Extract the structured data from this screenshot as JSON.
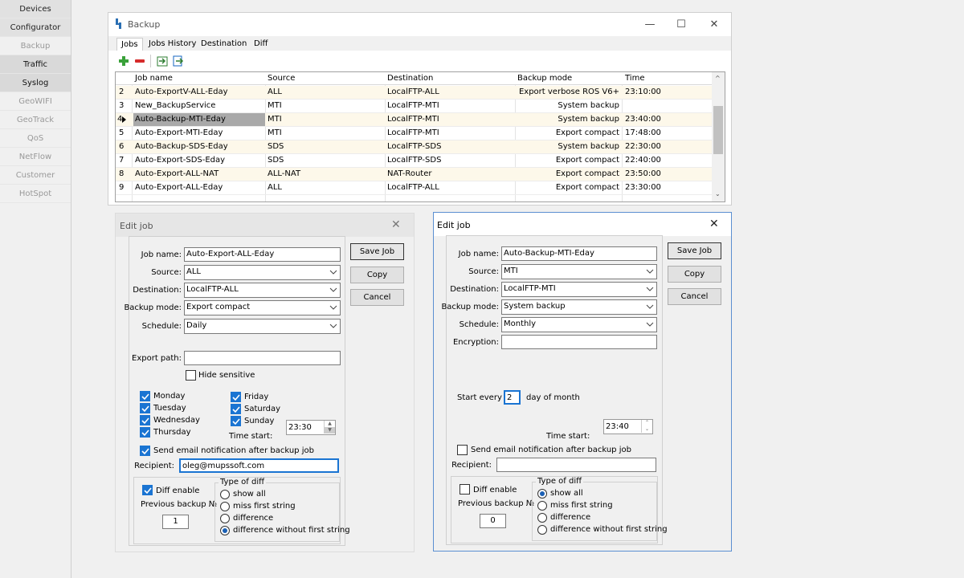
{
  "sidebar": {
    "items": [
      "Devices",
      "Configurator",
      "Backup",
      "Traffic",
      "Syslog",
      "GeoWIFI",
      "GeoTrack",
      "QoS",
      "NetFlow",
      "Customer",
      "HotSpot"
    ]
  },
  "window": {
    "title": "Backup",
    "tabs": [
      "Jobs",
      "Jobs History",
      "Destination",
      "Diff"
    ]
  },
  "grid": {
    "columns": [
      "Job name",
      "Source",
      "Destination",
      "Backup mode",
      "Time"
    ],
    "rows": [
      {
        "num": "2",
        "name": "Auto-ExportV-ALL-Eday",
        "source": "ALL",
        "dest": "LocalFTP-ALL",
        "mode": "Export verbose ROS V6+",
        "time": "23:10:00"
      },
      {
        "num": "3",
        "name": "New_BackupService",
        "source": "MTI",
        "dest": "LocalFTP-MTI",
        "mode": "System backup",
        "time": ""
      },
      {
        "num": "4",
        "name": "Auto-Backup-MTI-Eday",
        "source": "MTI",
        "dest": "LocalFTP-MTI",
        "mode": "System backup",
        "time": "23:40:00"
      },
      {
        "num": "5",
        "name": "Auto-Export-MTI-Eday",
        "source": "MTI",
        "dest": "LocalFTP-MTI",
        "mode": "Export compact",
        "time": "17:48:00"
      },
      {
        "num": "6",
        "name": "Auto-Backup-SDS-Eday",
        "source": "SDS",
        "dest": "LocalFTP-SDS",
        "mode": "System backup",
        "time": "22:30:00"
      },
      {
        "num": "7",
        "name": "Auto-Export-SDS-Eday",
        "source": "SDS",
        "dest": "LocalFTP-SDS",
        "mode": "Export compact",
        "time": "22:40:00"
      },
      {
        "num": "8",
        "name": "Auto-Export-ALL-NAT",
        "source": "ALL-NAT",
        "dest": "NAT-Router",
        "mode": "Export compact",
        "time": "23:50:00"
      },
      {
        "num": "9",
        "name": "Auto-Export-ALL-Eday",
        "source": "ALL",
        "dest": "LocalFTP-ALL",
        "mode": "Export compact",
        "time": "23:30:00"
      }
    ]
  },
  "edit1": {
    "title": "Edit job",
    "labels": {
      "jobname": "Job name:",
      "source": "Source:",
      "destination": "Destination:",
      "mode": "Backup mode:",
      "schedule": "Schedule:",
      "exportpath": "Export path:",
      "hide": "Hide sensitive",
      "timestart": "Time start:",
      "notify": "Send email notification after backup job",
      "recipient": "Recipient:",
      "diffenable": "Diff enable",
      "prevbackup": "Previous backup №",
      "typeofdiff": "Type of diff"
    },
    "values": {
      "jobname": "Auto-Export-ALL-Eday",
      "source": "ALL",
      "destination": "LocalFTP-ALL",
      "mode": "Export compact",
      "schedule": "Daily",
      "exportpath": "",
      "time": "23:30",
      "recipient": "oleg@mupssoft.com",
      "prev": "1"
    },
    "days": [
      "Monday",
      "Tuesday",
      "Wednesday",
      "Thursday",
      "Friday",
      "Saturday",
      "Sunday"
    ],
    "diff_types": [
      "show all",
      "miss first string",
      "difference",
      "difference without first string"
    ],
    "buttons": {
      "save": "Save Job",
      "copy": "Copy",
      "cancel": "Cancel"
    }
  },
  "edit2": {
    "title": "Edit job",
    "labels": {
      "jobname": "Job name:",
      "source": "Source:",
      "destination": "Destination:",
      "mode": "Backup mode:",
      "schedule": "Schedule:",
      "encryption": "Encryption:",
      "startevery": "Start every",
      "dayofmonth": "day of month",
      "timestart": "Time start:",
      "notify": "Send email notification after backup job",
      "recipient": "Recipient:",
      "diffenable": "Diff enable",
      "prevbackup": "Previous backup №",
      "typeofdiff": "Type of diff"
    },
    "values": {
      "jobname": "Auto-Backup-MTI-Eday",
      "source": "MTI",
      "destination": "LocalFTP-MTI",
      "mode": "System backup",
      "schedule": "Monthly",
      "encryption": "",
      "day": "2",
      "time": "23:40",
      "recipient": "",
      "prev": "0"
    },
    "diff_types": [
      "show all",
      "miss first string",
      "difference",
      "difference without first string"
    ],
    "buttons": {
      "save": "Save Job",
      "copy": "Copy",
      "cancel": "Cancel"
    }
  }
}
